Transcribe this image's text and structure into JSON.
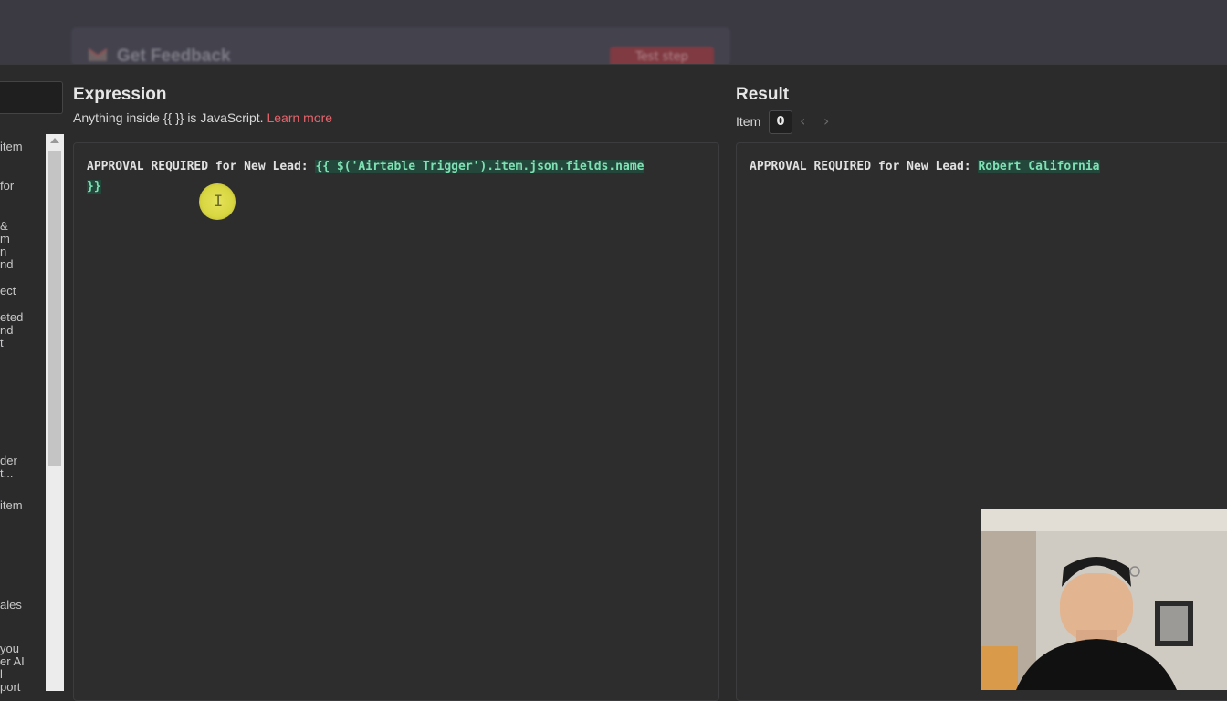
{
  "background": {
    "node_title": "Get Feedback",
    "test_button": "Test step"
  },
  "left_panel": {
    "items": [
      "item",
      "for",
      "&",
      "m",
      "n",
      "nd",
      "ect",
      "eted",
      "nd",
      "t",
      "der",
      "t...",
      "item",
      "ales",
      "you",
      "er AI",
      "l-",
      "port"
    ]
  },
  "expression": {
    "heading": "Expression",
    "hint_prefix": "Anything inside {{ }} is JavaScript.",
    "learn_more": "Learn more",
    "code_prefix": "APPROVAL REQUIRED for New Lead: ",
    "code_expression_line1": "{{ $('Airtable Trigger').item.json.fields.name",
    "code_expression_line2": "}}"
  },
  "result": {
    "heading": "Result",
    "item_label": "Item",
    "item_index": "0",
    "output_prefix": "APPROVAL REQUIRED for New Lead: ",
    "output_value": "Robert California"
  },
  "colors": {
    "accent_link": "#e8646b",
    "expression_bg": "#23473a",
    "expression_text": "#7fe0b4"
  }
}
